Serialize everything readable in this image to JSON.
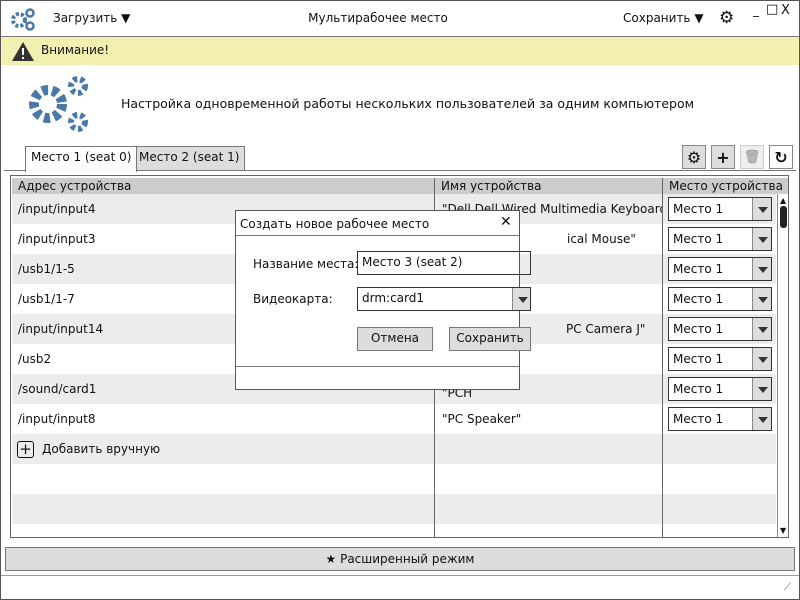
{
  "window": {
    "title": "Мультирабочее место",
    "load_label": "Загрузить",
    "save_label": "Сохранить",
    "minimize": "_",
    "maximize": "□",
    "close": "X"
  },
  "warning": {
    "text": "Внимание!"
  },
  "banner": {
    "text": "Настройка одновременной работы нескольких пользователей за одним компьютером"
  },
  "tabs": [
    {
      "label": "Место 1 (seat 0)",
      "active": true
    },
    {
      "label": "Место 2 (seat 1)",
      "active": false
    }
  ],
  "table": {
    "columns": [
      "Адрес устройства",
      "Имя устройства",
      "Место устройства"
    ],
    "rows": [
      {
        "address": "/input/input4",
        "name": "\"Dell Dell Wired Multimedia Keyboard\"",
        "seat": "Место 1"
      },
      {
        "address": "/input/input3",
        "name": "ical Mouse\"",
        "seat": "Место 1"
      },
      {
        "address": "/usb1/1-5",
        "name": "",
        "seat": "Место 1"
      },
      {
        "address": "/usb1/1-7",
        "name": "",
        "seat": "Место 1"
      },
      {
        "address": "/input/input14",
        "name": "PC Camera J\"",
        "seat": "Место 1"
      },
      {
        "address": "/usb2",
        "name": "",
        "seat": "Место 1"
      },
      {
        "address": "/sound/card1",
        "name": "\"PCH",
        "seat": "Место 1"
      },
      {
        "address": "/input/input8",
        "name": "\"PC Speaker\"",
        "seat": "Место 1"
      }
    ],
    "add_manual": "Добавить вручную"
  },
  "advanced": {
    "label": "Расширенный режим"
  },
  "dialog": {
    "title": "Создать новое рабочее место",
    "name_label": "Название места:",
    "name_value": "Место 3 (seat 2)",
    "gpu_label": "Видеокарта:",
    "gpu_value": "drm:card1",
    "cancel": "Отмена",
    "save": "Сохранить"
  },
  "colors": {
    "accent": "#4a78a8",
    "warning_bg": "#f2f0b0"
  }
}
